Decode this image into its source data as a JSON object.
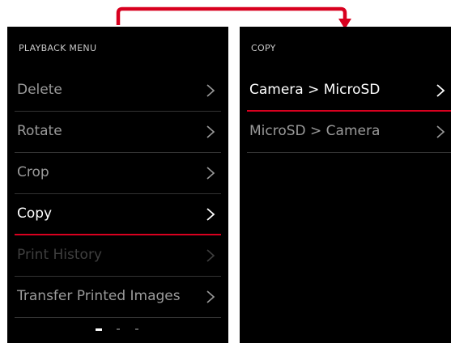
{
  "colors": {
    "accent_red": "#d8001f",
    "screen_bg": "#000000",
    "text_active": "#ffffff",
    "text_normal": "#9a9a9a",
    "text_disabled": "#3f3f3f",
    "divider": "#333333"
  },
  "left_screen": {
    "title": "PLAYBACK MENU",
    "items": [
      {
        "label": "Delete",
        "state": "normal",
        "icon": "chevron-right-icon"
      },
      {
        "label": "Rotate",
        "state": "normal",
        "icon": "chevron-right-icon"
      },
      {
        "label": "Crop",
        "state": "normal",
        "icon": "chevron-right-icon"
      },
      {
        "label": "Copy",
        "state": "selected",
        "icon": "chevron-right-icon"
      },
      {
        "label": "Print History",
        "state": "disabled",
        "icon": "chevron-right-icon"
      },
      {
        "label": "Transfer Printed Images",
        "state": "normal",
        "icon": "chevron-right-icon"
      }
    ],
    "pagination": {
      "pages": 3,
      "current": 1
    }
  },
  "right_screen": {
    "title": "COPY",
    "items": [
      {
        "label": "Camera > MicroSD",
        "state": "selected",
        "icon": "chevron-right-icon"
      },
      {
        "label": "MicroSD > Camera",
        "state": "normal",
        "icon": "chevron-right-icon"
      }
    ]
  },
  "connector": {
    "icon": "arrow-connector-icon"
  }
}
